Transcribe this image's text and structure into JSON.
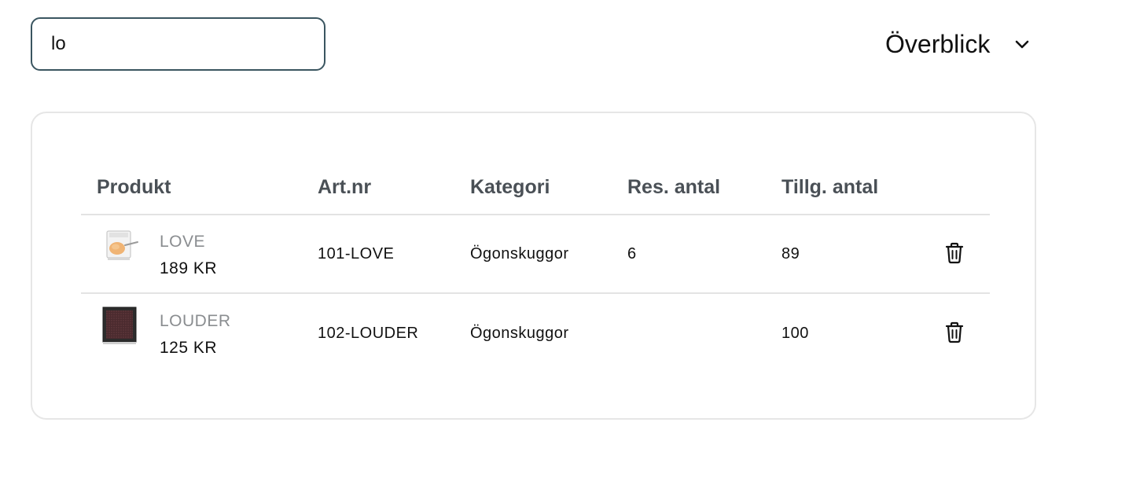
{
  "search": {
    "value": "lo"
  },
  "view_selector": {
    "selected": "Överblick"
  },
  "table": {
    "headers": [
      "Produkt",
      "Art.nr",
      "Kategori",
      "Res. antal",
      "Tillg. antal"
    ],
    "rows": [
      {
        "name": "LOVE",
        "price": "189 KR",
        "article_no": "101-LOVE",
        "category": "Ögonskuggor",
        "reserved": "6",
        "available": "89"
      },
      {
        "name": "LOUDER",
        "price": "125 KR",
        "article_no": "102-LOUDER",
        "category": "Ögonskuggor",
        "reserved": "",
        "available": "100"
      }
    ]
  },
  "icons": {
    "view_selector": "chevron-down-icon",
    "row_action": "trash-icon"
  },
  "colors": {
    "search_border": "#3a5560",
    "header_text": "#4a5056",
    "product_name": "#8a8d90"
  }
}
